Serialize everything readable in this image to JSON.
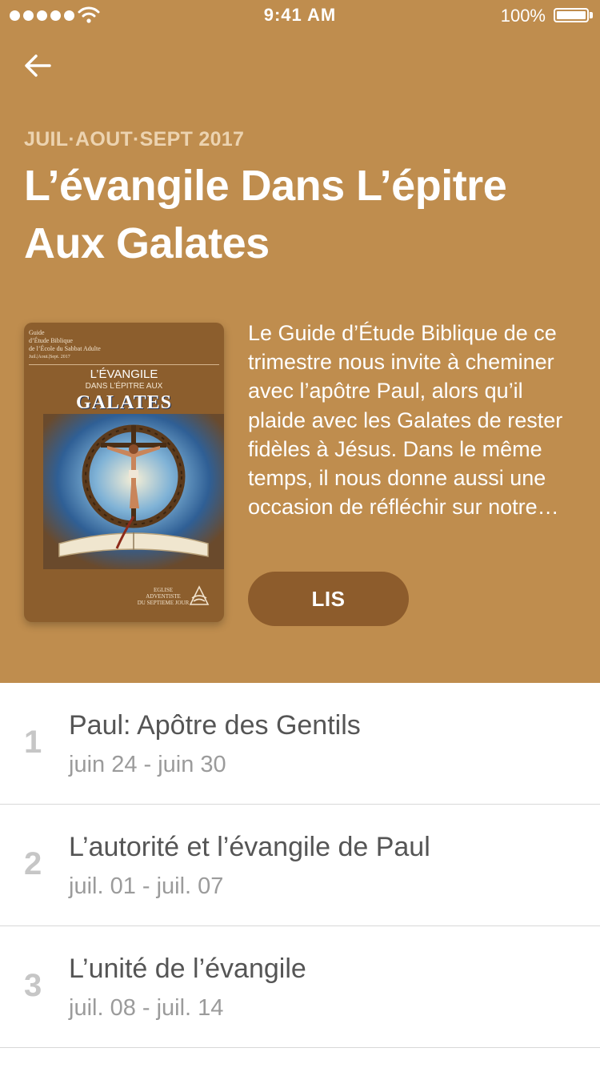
{
  "status_bar": {
    "time": "9:41 AM",
    "battery": "100%"
  },
  "header": {
    "season": "JUIL·AOUT·SEPT 2017",
    "title": "L’évangile Dans L’épitre Aux Galates",
    "description": "Le Guide d’Étude Biblique de ce trimestre nous invite à cheminer avec l’apôtre Paul, alors qu’il plaide avec les Galates de rester fidèles à Jésus. Dans le même temps, il nous donne aussi une occasion de réfléchir sur notre…",
    "read_button": "LIS",
    "background_color": "#bf8d4e",
    "button_color": "#8d5c2c"
  },
  "cover": {
    "guide_text": "Guide\nd’Étude Biblique\nde l’École du Sabbat Adulte",
    "dates": "Juil.|Aout.|Sept. 2017",
    "title_line1": "L’ÉVANGILE",
    "title_line2": "DANS L’ÉPITRE AUX",
    "title_line3": "GALATES",
    "publisher": "EGLISE\nADVENTISTE\nDU SEPTIEME JOUR"
  },
  "lessons": [
    {
      "number": "1",
      "title": "Paul: Apôtre des Gentils",
      "dates": "juin 24 - juin 30"
    },
    {
      "number": "2",
      "title": "L’autorité et l’évangile de Paul",
      "dates": "juil. 01 - juil. 07"
    },
    {
      "number": "3",
      "title": "L’unité de l’évangile",
      "dates": "juil. 08 - juil. 14"
    }
  ]
}
